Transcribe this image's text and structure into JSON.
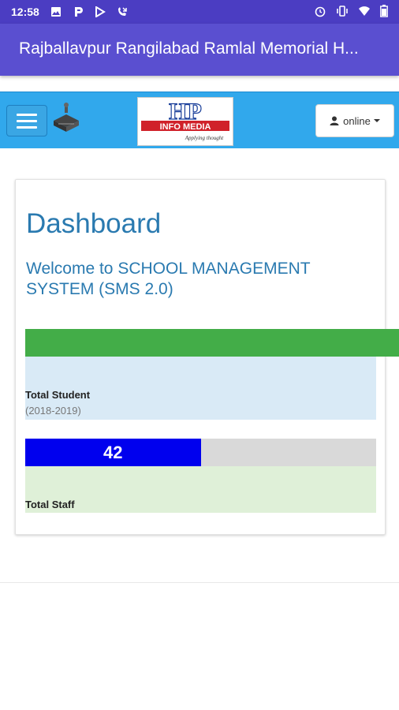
{
  "status_bar": {
    "time": "12:58",
    "notification_icons": [
      "image-icon",
      "p-icon",
      "play-store-icon",
      "missed-call-icon"
    ],
    "system_icons": [
      "alarm-icon",
      "vibrate-icon",
      "wifi-icon",
      "battery-icon"
    ]
  },
  "app_bar": {
    "title": "Rajballavpur Rangilabad Ramlal Memorial H..."
  },
  "nav": {
    "menu_icon": "hamburger-icon",
    "brand_top": "HP",
    "brand_mid": "INFO MEDIA",
    "brand_tag": "Applying thought",
    "online_label": "online"
  },
  "dashboard": {
    "title": "Dashboard",
    "welcome": "Welcome to SCHOOL MANAGEMENT SYSTEM (SMS 2.0)",
    "stats": [
      {
        "label": "Total Student",
        "sub": "(2018-2019)",
        "bar_text": "",
        "progress": 1.0,
        "bar_color": "#43ad48"
      },
      {
        "label": "Total Staff",
        "bar_text": "42",
        "progress": 0.5,
        "bar_color": "#0000ee"
      }
    ]
  },
  "colors": {
    "status_bar": "#4b3dc2",
    "app_bar": "#5a4fd0",
    "nav_bar": "#31a8ec",
    "heading": "#2a7ab0"
  }
}
